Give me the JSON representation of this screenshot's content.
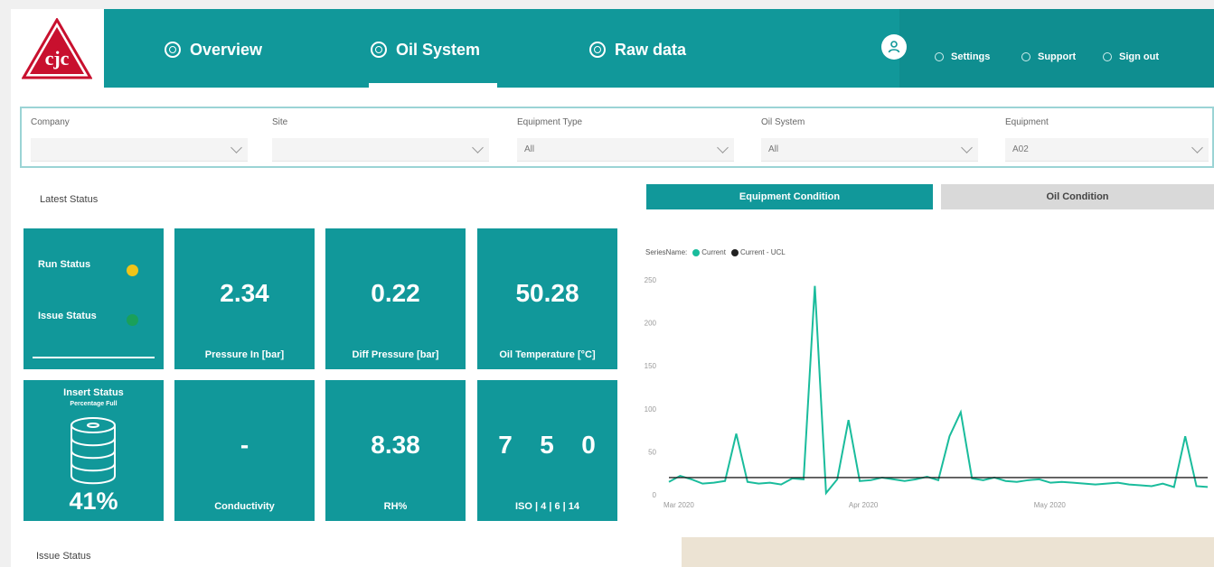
{
  "nav": {
    "items": [
      {
        "label": "Overview"
      },
      {
        "label": "Oil System"
      },
      {
        "label": "Raw data"
      }
    ],
    "user_links": [
      {
        "label": "Settings"
      },
      {
        "label": "Support"
      },
      {
        "label": "Sign out"
      }
    ],
    "brand_color": "#11989a",
    "logo_text": "cjc"
  },
  "filters": [
    {
      "label": "Company",
      "value": ""
    },
    {
      "label": "Site",
      "value": ""
    },
    {
      "label": "Equipment Type",
      "value": "All"
    },
    {
      "label": "Oil System",
      "value": "All"
    },
    {
      "label": "Equipment",
      "value": "A02"
    }
  ],
  "latest_status_title": "Latest Status",
  "issue_status_title": "Issue Status",
  "status_tile": {
    "run_label": "Run Status",
    "run_color": "#f0c419",
    "issue_label": "Issue Status",
    "issue_color": "#1aa05a"
  },
  "tiles": {
    "pressure_in": {
      "value": "2.34",
      "label": "Pressure In [bar]"
    },
    "diff_pressure": {
      "value": "0.22",
      "label": "Diff Pressure [bar]"
    },
    "oil_temperature": {
      "value": "50.28",
      "label": "Oil Temperature [°C]"
    },
    "insert_status": {
      "title": "Insert Status",
      "subtitle": "Percentage Full",
      "value": "41%",
      "percent": 41
    },
    "conductivity": {
      "value": "-",
      "label": "Conductivity"
    },
    "rh": {
      "value": "8.38",
      "label": "RH%"
    },
    "iso": {
      "values": [
        "7",
        "5",
        "0"
      ],
      "label": "ISO | 4 | 6 | 14"
    }
  },
  "toggles": {
    "equipment": "Equipment Condition",
    "oil": "Oil Condition",
    "active": "equipment"
  },
  "chart_data": {
    "type": "line",
    "legend_title": "SeriesName",
    "x_ticks": [
      "Mar 2020",
      "Apr 2020",
      "May 2020"
    ],
    "y_ticks": [
      0,
      50,
      100,
      150,
      200,
      250
    ],
    "ylim": [
      0,
      250
    ],
    "series": [
      {
        "name": "Current",
        "color": "#1abc9c",
        "x_day": [
          0,
          2,
          4,
          6,
          8,
          10,
          12,
          14,
          16,
          18,
          20,
          22,
          24,
          26,
          28,
          30,
          32,
          34,
          36,
          38,
          40,
          42,
          44,
          46,
          48,
          50,
          52,
          54,
          56,
          58,
          60,
          62,
          64,
          66,
          68,
          70,
          72,
          74,
          76,
          78,
          80,
          82,
          84,
          86,
          88,
          90,
          92,
          94,
          96
        ],
        "y": [
          15,
          22,
          18,
          13,
          14,
          16,
          71,
          15,
          13,
          14,
          12,
          19,
          18,
          243,
          2,
          18,
          87,
          16,
          17,
          20,
          18,
          16,
          18,
          21,
          17,
          68,
          96,
          19,
          17,
          20,
          16,
          15,
          17,
          18,
          14,
          15,
          14,
          13,
          12,
          13,
          14,
          12,
          11,
          10,
          13,
          9,
          68,
          10,
          9
        ]
      },
      {
        "name": "Current - UCL",
        "color": "#222222",
        "x_day": [
          0,
          96
        ],
        "y": [
          20,
          20
        ]
      }
    ]
  }
}
